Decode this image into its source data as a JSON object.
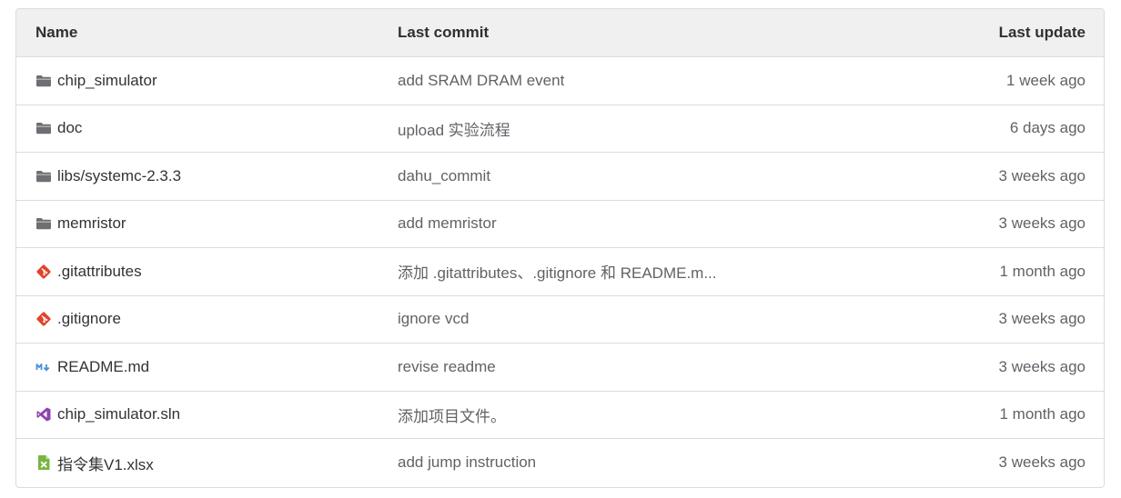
{
  "header": {
    "name": "Name",
    "last_commit": "Last commit",
    "last_update": "Last update"
  },
  "rows": [
    {
      "name": "chip_simulator",
      "icon": "folder-icon",
      "commit": "add SRAM DRAM event",
      "updated": "1 week ago"
    },
    {
      "name": "doc",
      "icon": "folder-icon",
      "commit": "upload 实验流程",
      "updated": "6 days ago"
    },
    {
      "name": "libs/systemc-2.3.3",
      "icon": "folder-icon",
      "commit": "dahu_commit",
      "updated": "3 weeks ago"
    },
    {
      "name": "memristor",
      "icon": "folder-icon",
      "commit": "add memristor",
      "updated": "3 weeks ago"
    },
    {
      "name": ".gitattributes",
      "icon": "git-icon",
      "commit": "添加 .gitattributes、.gitignore 和 README.m...",
      "updated": "1 month ago"
    },
    {
      "name": ".gitignore",
      "icon": "git-icon",
      "commit": "ignore vcd",
      "updated": "3 weeks ago"
    },
    {
      "name": "README.md",
      "icon": "markdown-icon",
      "commit": "revise readme",
      "updated": "3 weeks ago"
    },
    {
      "name": "chip_simulator.sln",
      "icon": "visual-studio-icon",
      "commit": "添加项目文件。",
      "updated": "1 month ago"
    },
    {
      "name": "指令集V1.xlsx",
      "icon": "excel-icon",
      "commit": "add jump instruction",
      "updated": "3 weeks ago"
    }
  ],
  "colors": {
    "folder": "#6e6e73",
    "git": "#e24329",
    "markdown": "#4a90d9",
    "visual_studio": "#8e44ad",
    "excel": "#7cb342"
  }
}
